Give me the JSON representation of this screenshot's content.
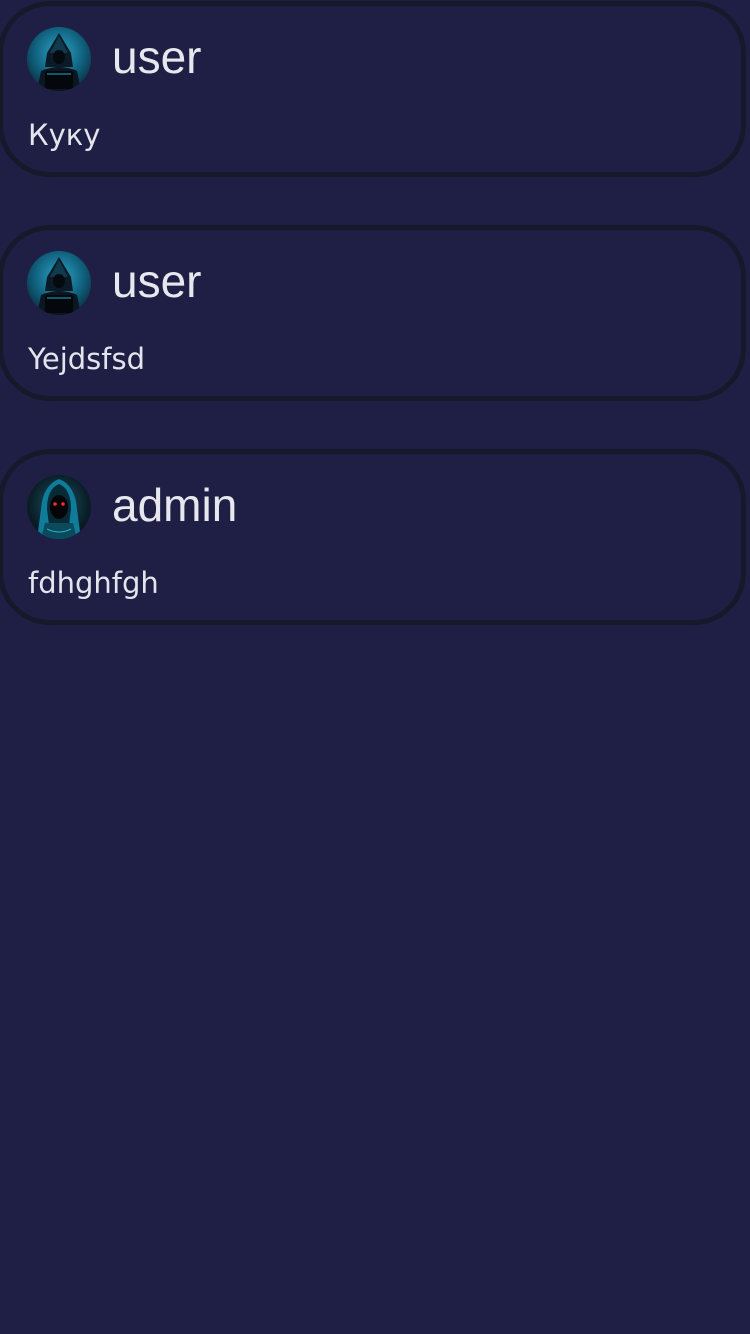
{
  "posts": [
    {
      "author": "user",
      "avatar": "hooded-figure-laptop-avatar-icon",
      "text": "Куку"
    },
    {
      "author": "user",
      "avatar": "hooded-figure-laptop-avatar-icon",
      "text": "Yejdsfsd"
    },
    {
      "author": "admin",
      "avatar": "hooded-figure-red-eyes-avatar-icon",
      "text": "fdhghfgh"
    }
  ],
  "colors": {
    "background": "#1f1e45",
    "card_border": "#17192a",
    "text": "#e6e6ee",
    "accent_cyan": "#1b8fb0"
  }
}
